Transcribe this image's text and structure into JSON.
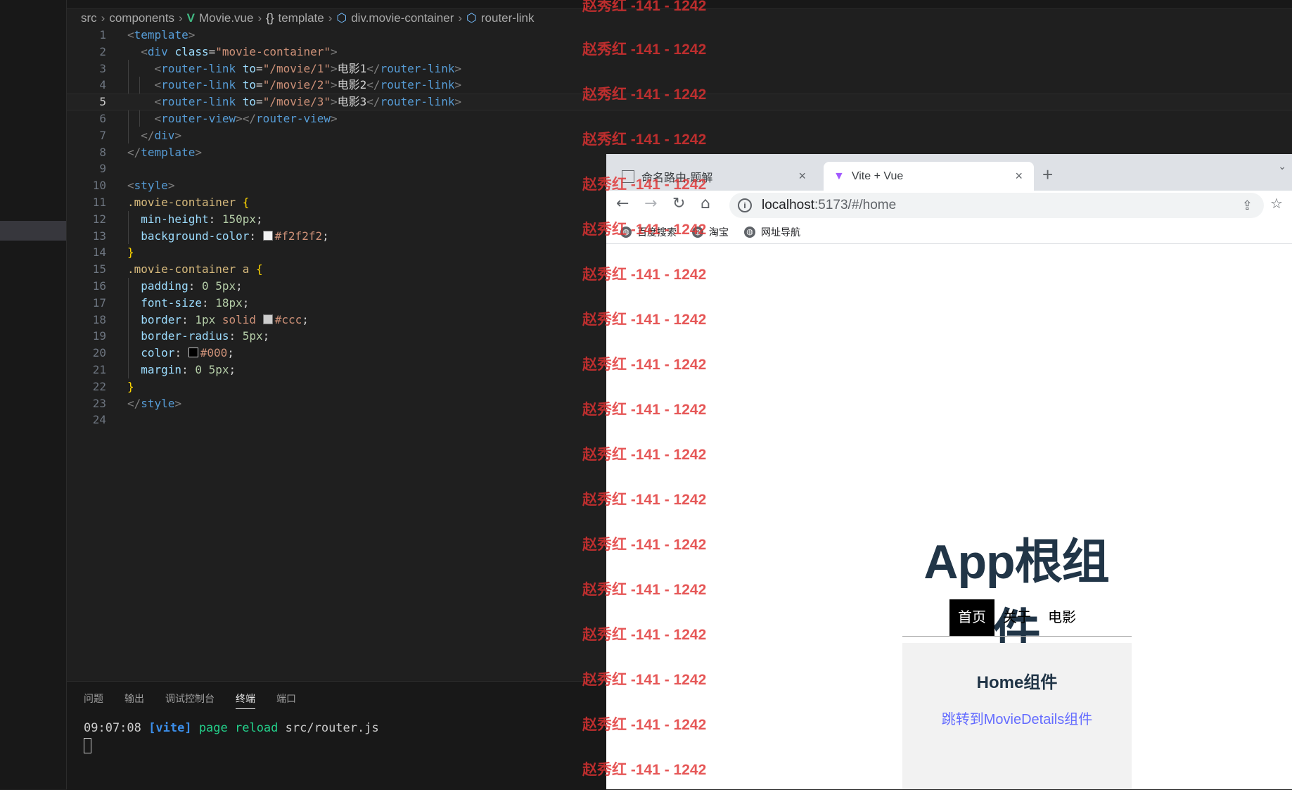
{
  "breadcrumb": {
    "items": [
      "src",
      "components",
      "Movie.vue",
      "template",
      "div.movie-container",
      "router-link"
    ],
    "icons": [
      "",
      "",
      "vue-icon",
      "braces-icon",
      "cube-icon",
      "cube-icon"
    ]
  },
  "code": {
    "line_numbers": [
      "1",
      "2",
      "3",
      "4",
      "5",
      "6",
      "7",
      "8",
      "9",
      "10",
      "11",
      "12",
      "13",
      "14",
      "15",
      "16",
      "17",
      "18",
      "19",
      "20",
      "21",
      "22",
      "23",
      "24"
    ],
    "current_line": 5,
    "lines": [
      "<template>",
      "  <div class=\"movie-container\">",
      "    <router-link to=\"/movie/1\">电影1</router-link>",
      "    <router-link to=\"/movie/2\">电影2</router-link>",
      "    <router-link to=\"/movie/3\">电影3</router-link>",
      "    <router-view></router-view>",
      "  </div>",
      "</template>",
      "",
      "<style>",
      ".movie-container {",
      "  min-height: 150px;",
      "  background-color: #f2f2f2;",
      "}",
      ".movie-container a {",
      "  padding: 0 5px;",
      "  font-size: 18px;",
      "  border: 1px solid #ccc;",
      "  border-radius: 5px;",
      "  color: #000;",
      "  margin: 0 5px;",
      "}",
      "</style>",
      ""
    ],
    "swatch_colors": [
      "#f2f2f2",
      "#cccccc",
      "#000000"
    ]
  },
  "panel": {
    "tabs": [
      "问题",
      "输出",
      "调试控制台",
      "终端",
      "端口"
    ],
    "active_tab": "终端",
    "terminal": {
      "time": "09:07:08",
      "tag": "[vite]",
      "message": "page reload",
      "file": "src/router.js"
    }
  },
  "browser": {
    "tabs": [
      {
        "title": "命名路由-题解",
        "close": "×"
      },
      {
        "title": "Vite + Vue",
        "close": "×"
      }
    ],
    "new_tab": "+",
    "url_host": "localhost",
    "url_rest": ":5173/#/home",
    "bookmarks": [
      "百度搜索",
      "淘宝",
      "网址导航"
    ]
  },
  "app": {
    "title": "App根组件",
    "nav": [
      "首页",
      "关于",
      "电影"
    ],
    "active_nav": "首页",
    "home_title": "Home组件",
    "home_link": "跳转到MovieDetails组件"
  },
  "watermark": {
    "text": "赵秀红 -141 - 1242"
  },
  "colors": {
    "editor_bg": "#1f1f1f",
    "tag_blue": "#569cd6",
    "string_orange": "#ce9178",
    "link_purple": "#646cff",
    "watermark_red": "#e03232"
  }
}
